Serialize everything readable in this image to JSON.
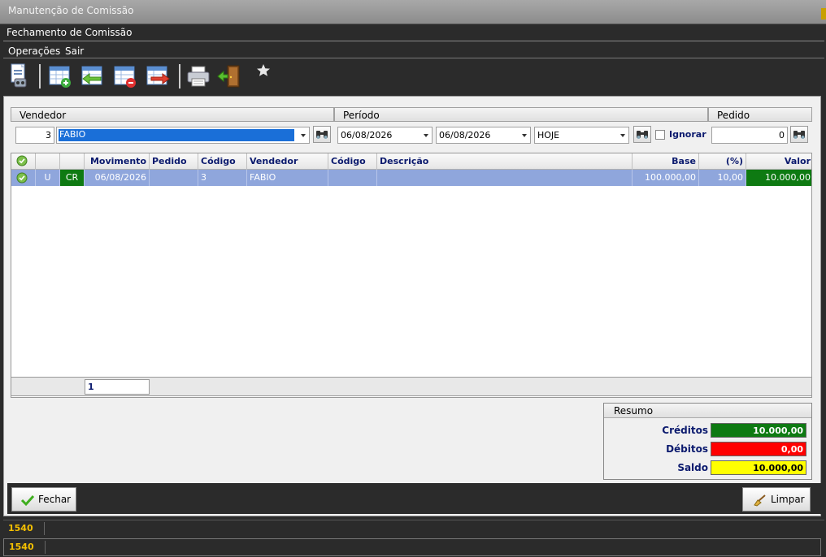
{
  "window": {
    "title": "Manutenção de Comissão",
    "subtitle": "Fechamento de Comissão"
  },
  "menu": [
    {
      "label": "Operações"
    },
    {
      "label": "Sair"
    }
  ],
  "filters": {
    "vendedor_header": "Vendedor",
    "periodo_header": "Período",
    "pedido_header": "Pedido",
    "vendedor_code": "3",
    "vendedor_name": "FABIO",
    "date_from": "06/08/2026",
    "date_to": "06/08/2026",
    "period_option": "HOJE",
    "ignorar_label": "Ignorar",
    "pedido_value": "0"
  },
  "grid": {
    "columns": [
      "Movimento",
      "Pedido",
      "Código",
      "Vendedor",
      "Código",
      "Descrição",
      "Base",
      "(%)",
      "Valor"
    ],
    "rows": [
      {
        "status": "U",
        "type": "CR",
        "movimento": "06/08/2026",
        "pedido": "",
        "codigo": "3",
        "vendedor": "FABIO",
        "codigo2": "",
        "descricao": "",
        "base": "100.000,00",
        "pct": "10,00",
        "valor": "10.000,00"
      }
    ],
    "page": "1"
  },
  "resumo": {
    "title": "Resumo",
    "creditos_label": "Créditos",
    "creditos": "10.000,00",
    "debitos_label": "Débitos",
    "debitos": "0,00",
    "saldo_label": "Saldo",
    "saldo": "10.000,00"
  },
  "buttons": {
    "fechar": "Fechar",
    "limpar": "Limpar"
  },
  "status": {
    "line1": "1540",
    "line2": "1540"
  },
  "colors": {
    "credit": "#008000",
    "debit": "#ff0000",
    "saldo": "#ffff00",
    "selected_row": "#8fa6dc",
    "header_text": "#0b1a6e"
  }
}
